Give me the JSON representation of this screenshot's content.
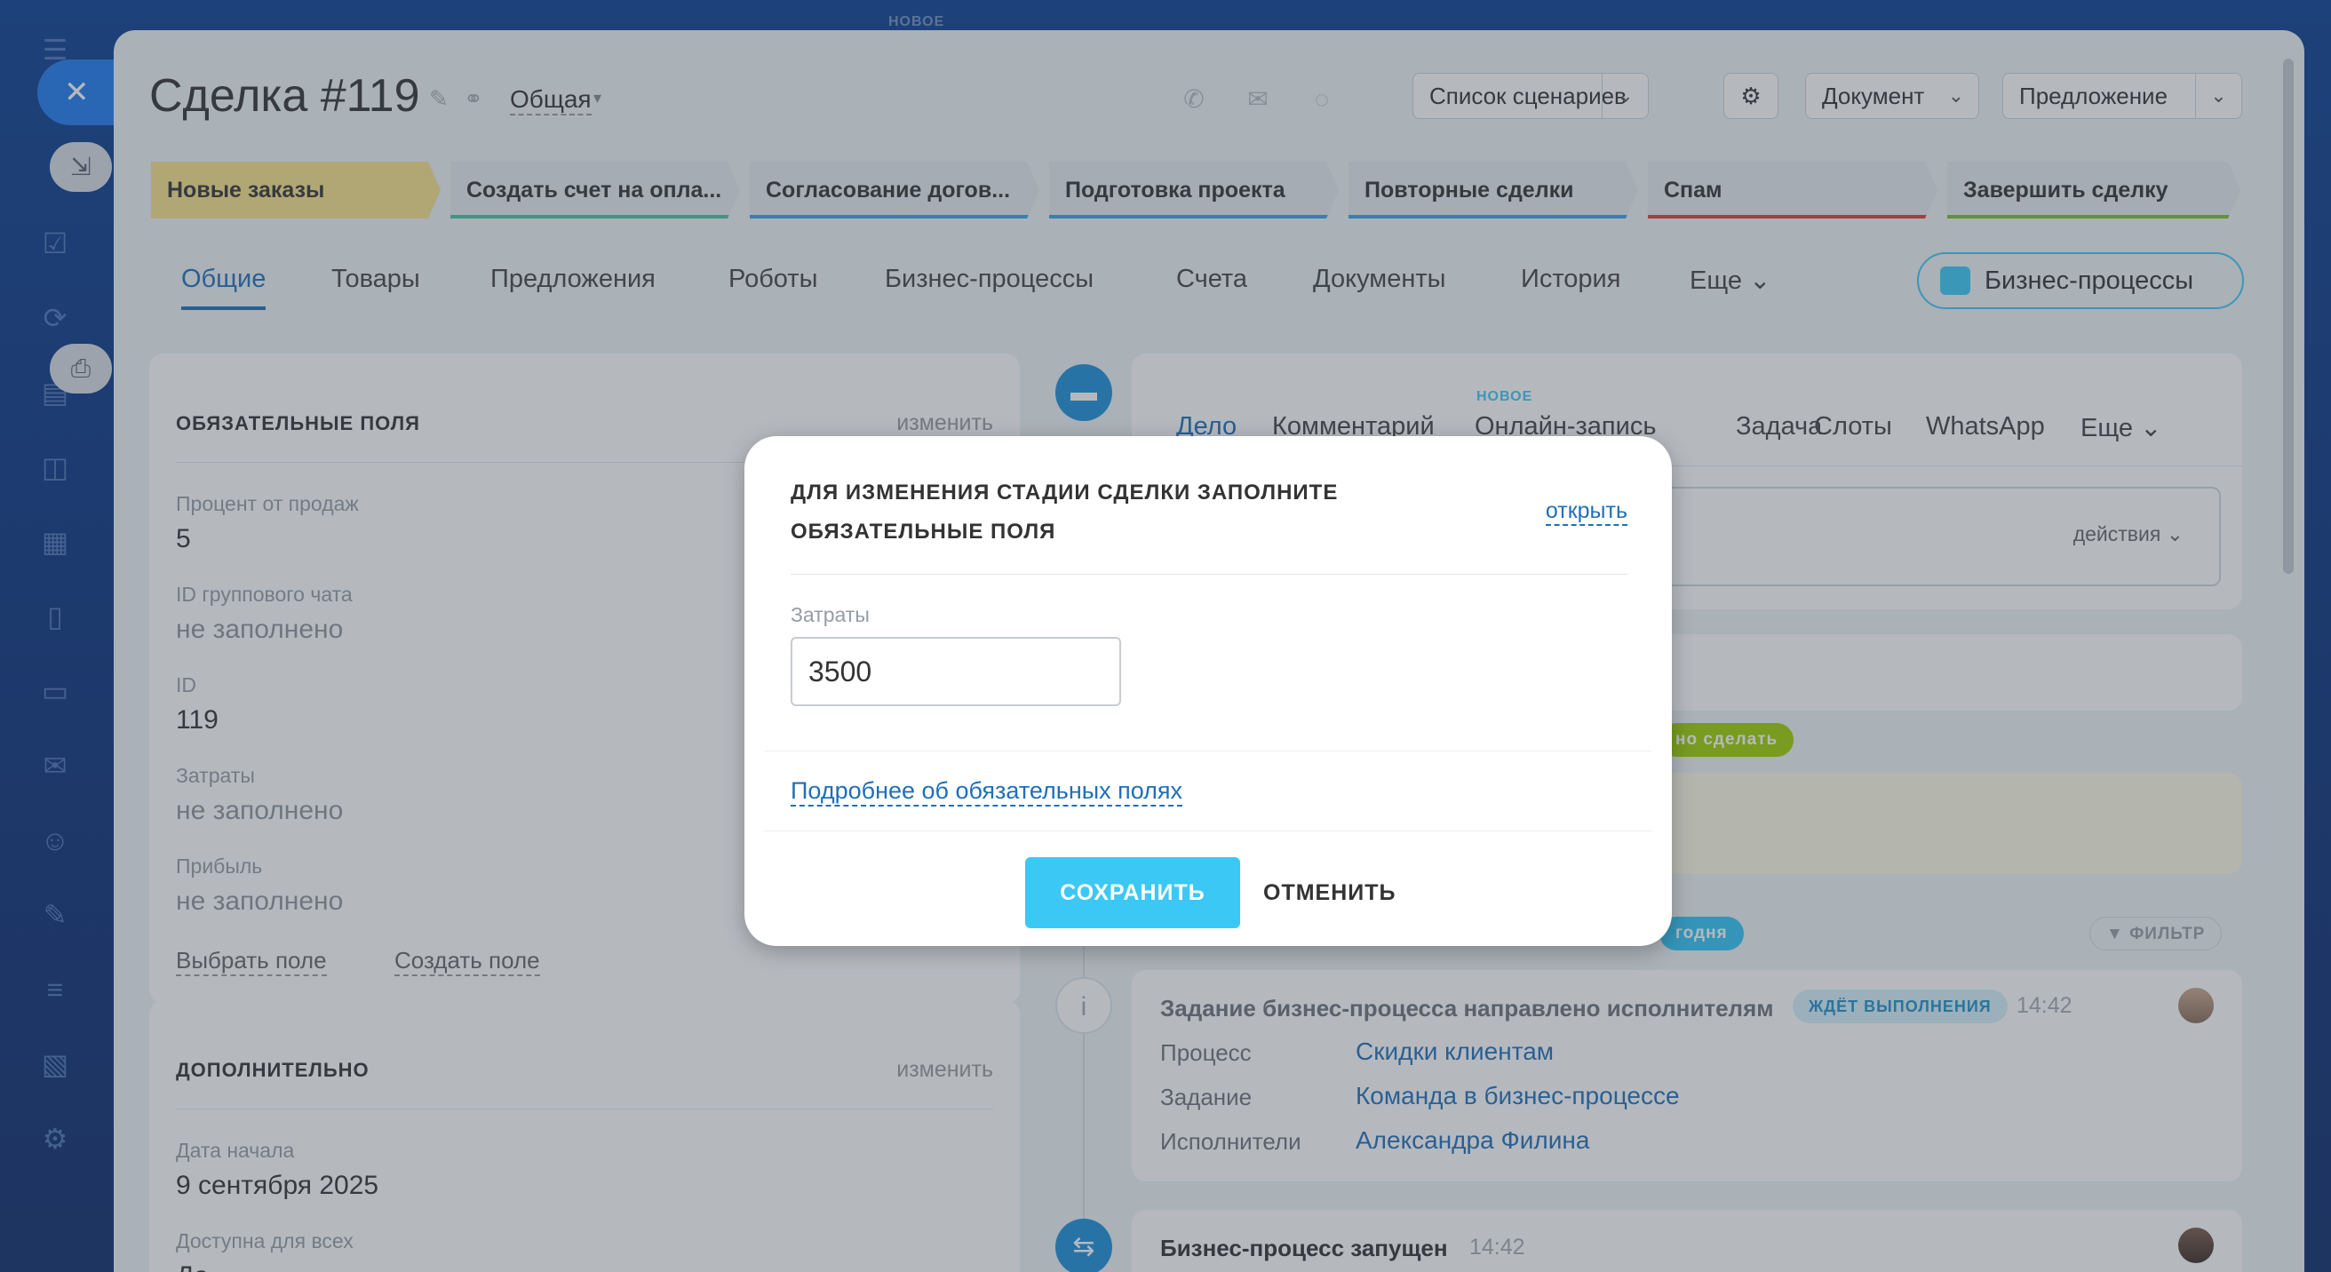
{
  "header": {
    "new_top": "НОВОЕ",
    "deal_title": "Сделка #119",
    "category": "Общая",
    "scenarios": "Список сценариев",
    "document": "Документ",
    "proposal": "Предложение"
  },
  "stages": [
    {
      "label": "Новые заказы",
      "color": "#f7e38a",
      "line": "#f7e38a"
    },
    {
      "label": "Создать счет на опла...",
      "color": "#e6eaee",
      "line": "#3bc8a0"
    },
    {
      "label": "Согласование догов...",
      "color": "#e6eaee",
      "line": "#2fa4e7"
    },
    {
      "label": "Подготовка проекта",
      "color": "#e6eaee",
      "line": "#2fa4e7"
    },
    {
      "label": "Повторные сделки",
      "color": "#e6eaee",
      "line": "#2fa4e7"
    },
    {
      "label": "Спам",
      "color": "#e6eaee",
      "line": "#e53935"
    },
    {
      "label": "Завершить сделку",
      "color": "#e6eaee",
      "line": "#7cc023"
    }
  ],
  "tabs": [
    "Общие",
    "Товары",
    "Предложения",
    "Роботы",
    "Бизнес-процессы",
    "Счета",
    "Документы",
    "История",
    "Еще"
  ],
  "bp_button": "Бизнес-процессы",
  "required_card": {
    "title": "ОБЯЗАТЕЛЬНЫЕ ПОЛЯ",
    "edit": "изменить",
    "fields": [
      {
        "label": "Процент от продаж",
        "value": "5"
      },
      {
        "label": "ID группового чата",
        "value": "не заполнено"
      },
      {
        "label": "ID",
        "value": "119"
      },
      {
        "label": "Затраты",
        "value": "не заполнено"
      },
      {
        "label": "Прибыль",
        "value": "не заполнено"
      }
    ],
    "select_field": "Выбрать поле",
    "create_field": "Создать поле"
  },
  "extra_card": {
    "title": "ДОПОЛНИТЕЛЬНО",
    "edit": "изменить",
    "fields": [
      {
        "label": "Дата начала",
        "value": "9 сентября 2025"
      },
      {
        "label": "Доступна для всех",
        "value": "Да"
      }
    ]
  },
  "timeline": {
    "tabs": [
      "Дело",
      "Комментарий",
      "Онлайн-запись",
      "Задача",
      "Слоты",
      "WhatsApp",
      "Еще"
    ],
    "new_badge": "НОВОЕ",
    "actions": "действия",
    "todo_badge": "но сделать",
    "today_badge": "годня",
    "filter": "ФИЛЬТР",
    "event1": {
      "title": "Задание бизнес-процесса направлено исполнителям",
      "badge": "ЖДЁТ ВЫПОЛНЕНИЯ",
      "time": "14:42",
      "rows": [
        {
          "key": "Процесс",
          "value": "Скидки клиентам"
        },
        {
          "key": "Задание",
          "value": "Команда в бизнес-процессе"
        },
        {
          "key": "Исполнители",
          "value": "Александра Филина"
        }
      ]
    },
    "event2": {
      "title": "Бизнес-процесс запущен",
      "time": "14:42"
    }
  },
  "modal": {
    "heading": "ДЛЯ ИЗМЕНЕНИЯ СТАДИИ СДЕЛКИ ЗАПОЛНИТЕ ОБЯЗАТЕЛЬНЫЕ ПОЛЯ",
    "open_link": "открыть",
    "field_label": "Затраты",
    "field_value": "3500",
    "more_link": "Подробнее об обязательных полях",
    "save": "СОХРАНИТЬ",
    "cancel": "ОТМЕНИТЬ"
  },
  "icons": {
    "close": "close-icon",
    "print": "printer-icon",
    "minimize": "minimize-icon"
  }
}
